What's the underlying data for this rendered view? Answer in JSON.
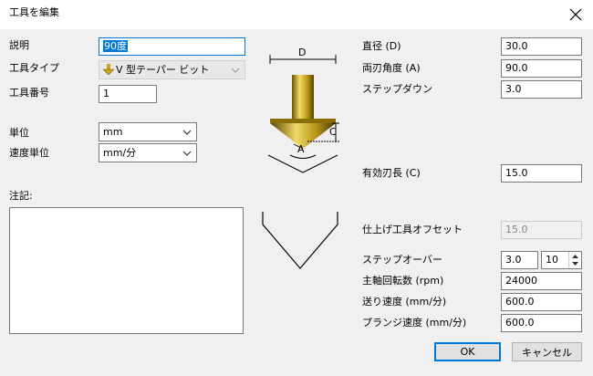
{
  "window": {
    "title": "工具を編集"
  },
  "form": {
    "description": {
      "label": "説明",
      "value": "90度"
    },
    "tool_type": {
      "label": "工具タイプ",
      "value": "V 型テーパー ビット"
    },
    "tool_number": {
      "label": "工具番号",
      "value": "1"
    },
    "unit": {
      "label": "単位",
      "value": "mm"
    },
    "speed_unit": {
      "label": "速度単位",
      "value": "mm/分"
    },
    "notes": {
      "label": "注記:",
      "value": ""
    },
    "diameter": {
      "label": "直径 (D)",
      "value": "30.0"
    },
    "included_angle": {
      "label": "両刃角度 (A)",
      "value": "90.0"
    },
    "stepdown": {
      "label": "ステップダウン",
      "value": "3.0"
    },
    "flute_length": {
      "label": "有効刃長 (C)",
      "value": "15.0"
    },
    "finish_offset": {
      "label": "仕上げ工具オフセット",
      "value": "15.0"
    },
    "stepover": {
      "label": "ステップオーバー",
      "value": "3.0",
      "percent": "10"
    },
    "spindle_speed": {
      "label": "主軸回転数 (rpm)",
      "value": "24000"
    },
    "feed_rate": {
      "label": "送り速度 (mm/分)",
      "value": "600.0"
    },
    "plunge_rate": {
      "label": "プランジ速度 (mm/分)",
      "value": "600.0"
    }
  },
  "diagram": {
    "d_label": "D",
    "c_label": "C",
    "a_label": "A"
  },
  "buttons": {
    "ok": "OK",
    "cancel": "キャンセル"
  },
  "colors": {
    "accent": "#0078d7",
    "gold": "#c9a41e"
  },
  "icons": {
    "close": "close-icon",
    "tool_type": "v-bit-icon",
    "dropdown": "chevron-down-icon"
  }
}
